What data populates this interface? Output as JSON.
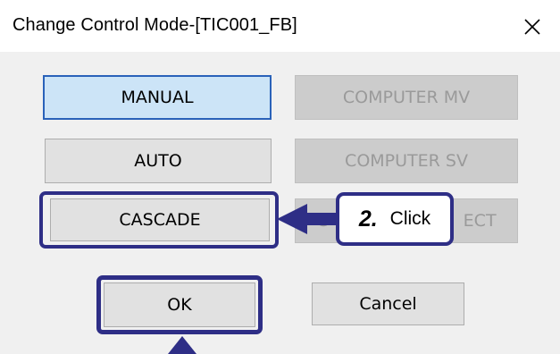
{
  "window": {
    "title": "Change Control Mode-[TIC001_FB]",
    "close_icon": "close-icon"
  },
  "buttons": {
    "manual": "MANUAL",
    "computer_mv": "COMPUTER MV",
    "auto": "AUTO",
    "computer_sv": "COMPUTER SV",
    "cascade": "CASCADE",
    "hidden_right": "C                         ECT",
    "ok": "OK",
    "cancel": "Cancel"
  },
  "annotation": {
    "step": "2.",
    "action": "Click",
    "color": "#2e2e86"
  }
}
